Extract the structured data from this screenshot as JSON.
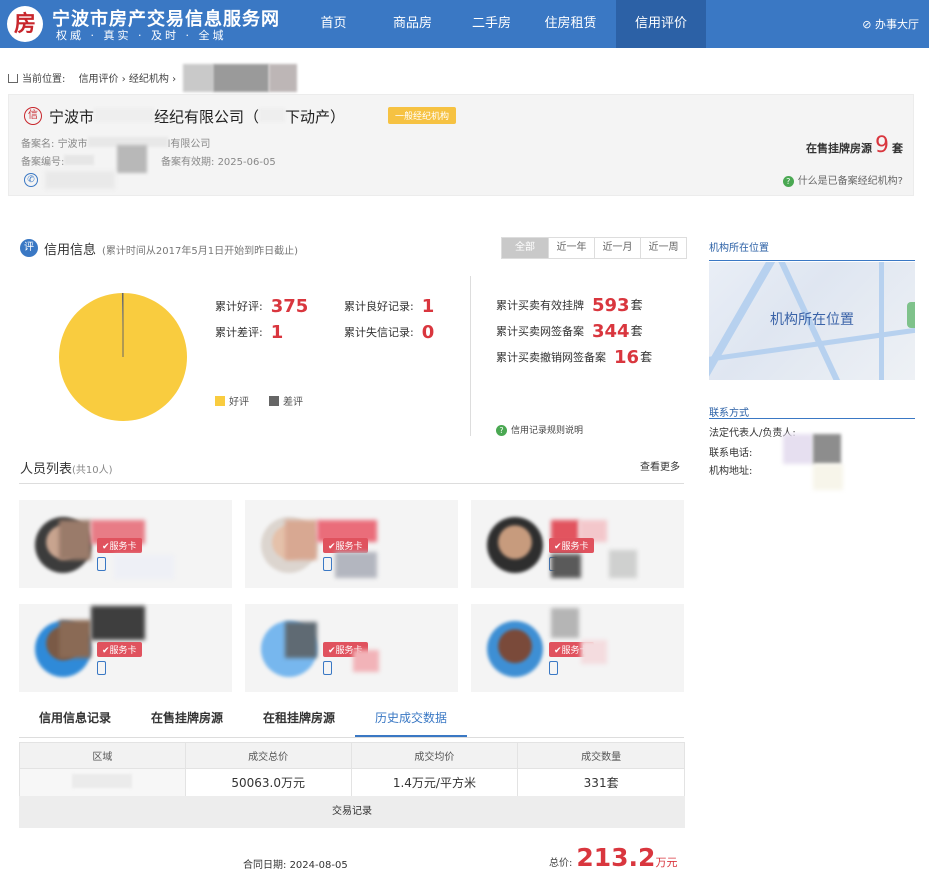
{
  "header": {
    "logo_char": "房",
    "site_title": "宁波市房产交易信息服务网",
    "slogan": "权威 · 真实 · 及时 · 全城",
    "nav": [
      "首页",
      "商品房",
      "二手房",
      "住房租赁",
      "信用评价"
    ],
    "active_nav": "信用评价",
    "office_link": "办事大厅"
  },
  "breadcrumb": {
    "label": "当前位置:",
    "path": "信用评价 › 经纪机构 ›"
  },
  "agency": {
    "icon_char": "信",
    "name_part1": "宁波市",
    "name_part2": "经纪有限公司（",
    "name_part3": "下动产）",
    "level_tag": "一般经纪机构",
    "record_name_label": "备案名:",
    "record_name_value": "宁波市",
    "record_name_tail": "l有限公司",
    "record_no_label": "备案编号:",
    "valid_label": "备案有效期:",
    "valid_value": "2025-06-05",
    "listing_label": "在售挂牌房源",
    "listing_count": "9",
    "listing_unit": "套",
    "what_link": "什么是已备案经纪机构?"
  },
  "credit": {
    "icon_char": "评",
    "title": "信用信息",
    "note": "(累计时间从2017年5月1日开始到昨日截止)",
    "ranges": [
      "全部",
      "近一年",
      "近一月",
      "近一周"
    ],
    "good_label": "累计好评:",
    "good_value": "375",
    "bad_label": "累计差评:",
    "bad_value": "1",
    "good_record_label": "累计良好记录:",
    "good_record_value": "1",
    "bad_record_label": "累计失信记录:",
    "bad_record_value": "0",
    "listed_label": "累计买卖有效挂牌",
    "listed_value": "593",
    "signed_label": "累计买卖网签备案",
    "signed_value": "344",
    "revoked_label": "累计买卖撤销网签备案",
    "revoked_value": "16",
    "unit": "套",
    "rules_link": "信用记录规则说明",
    "legend_good": "好评",
    "legend_bad": "差评",
    "colors": {
      "good": "#f9cc3f",
      "bad": "#666666"
    }
  },
  "chart_data": {
    "type": "pie",
    "categories": [
      "好评",
      "差评"
    ],
    "values": [
      375,
      1
    ]
  },
  "sidebar": {
    "map_title": "机构所在位置",
    "map_label": "机构所在位置",
    "contact_title": "联系方式",
    "legal_label": "法定代表人/负责人:",
    "phone_label": "联系电话:",
    "address_label": "机构地址:"
  },
  "people": {
    "title": "人员列表",
    "count": "(共10人)",
    "more": "查看更多",
    "badge": "服务卡"
  },
  "bottom_tabs": [
    "信用信息记录",
    "在售挂牌房源",
    "在租挂牌房源",
    "历史成交数据"
  ],
  "active_bottom_tab": "历史成交数据",
  "history": {
    "headers": [
      "区域",
      "成交总价",
      "成交均价",
      "成交数量"
    ],
    "row": [
      "",
      "50063.0万元",
      "1.4万元/平方米",
      "331套"
    ],
    "trade_records": "交易记录",
    "contract_label": "合同日期:",
    "contract_date": "2024-08-05",
    "total_label": "总价:",
    "total_value": "213.2",
    "total_unit": "万元"
  }
}
